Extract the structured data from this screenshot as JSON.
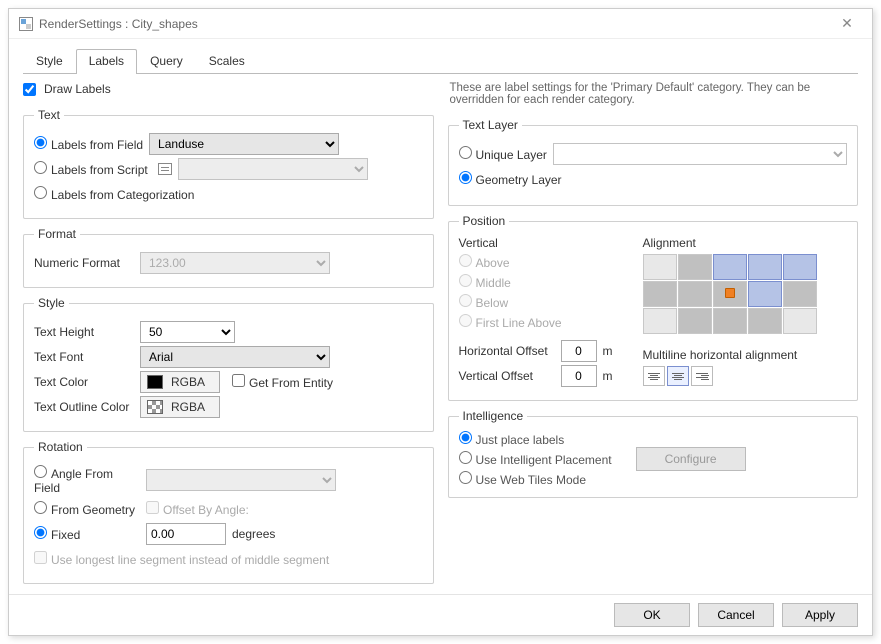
{
  "window": {
    "title": "RenderSettings : City_shapes"
  },
  "tabs": [
    "Style",
    "Labels",
    "Query",
    "Scales"
  ],
  "active_tab": "Labels",
  "description": "These are label settings for the 'Primary Default' category. They can be overridden for each render category.",
  "draw_labels": {
    "label": "Draw Labels",
    "checked": true
  },
  "text_group": {
    "legend": "Text",
    "from_field": {
      "label": "Labels from Field",
      "value": "Landuse"
    },
    "from_script": {
      "label": "Labels from Script"
    },
    "from_cat": {
      "label": "Labels from Categorization"
    }
  },
  "format_group": {
    "legend": "Format",
    "numeric_format": {
      "label": "Numeric Format",
      "value": "123.00"
    }
  },
  "style_group": {
    "legend": "Style",
    "text_height": {
      "label": "Text Height",
      "value": "50"
    },
    "text_font": {
      "label": "Text Font",
      "value": "Arial"
    },
    "text_color": {
      "label": "Text Color",
      "btn": "RGBA",
      "get_from_entity": "Get From Entity"
    },
    "outline_color": {
      "label": "Text Outline Color",
      "btn": "RGBA"
    }
  },
  "rotation_group": {
    "legend": "Rotation",
    "angle_from_field": {
      "label": "Angle From Field"
    },
    "from_geometry": {
      "label": "From Geometry",
      "offset_label": "Offset By Angle:"
    },
    "fixed": {
      "label": "Fixed",
      "value": "0.00",
      "unit": "degrees"
    },
    "longest": "Use longest line segment instead of middle segment"
  },
  "textlayer_group": {
    "legend": "Text Layer",
    "unique": {
      "label": "Unique Layer"
    },
    "geometry": {
      "label": "Geometry Layer"
    }
  },
  "position_group": {
    "legend": "Position",
    "vertical_label": "Vertical",
    "vertical_opts": [
      "Above",
      "Middle",
      "Below",
      "First Line Above"
    ],
    "h_offset": {
      "label": "Horizontal Offset",
      "value": "0",
      "unit": "m"
    },
    "v_offset": {
      "label": "Vertical Offset",
      "value": "0",
      "unit": "m"
    },
    "alignment_label": "Alignment",
    "multiline_label": "Multiline horizontal alignment"
  },
  "intelligence_group": {
    "legend": "Intelligence",
    "just_place": "Just place labels",
    "intelligent": "Use Intelligent Placement",
    "webtiles": "Use Web Tiles Mode",
    "configure": "Configure"
  },
  "footer": {
    "ok": "OK",
    "cancel": "Cancel",
    "apply": "Apply"
  }
}
